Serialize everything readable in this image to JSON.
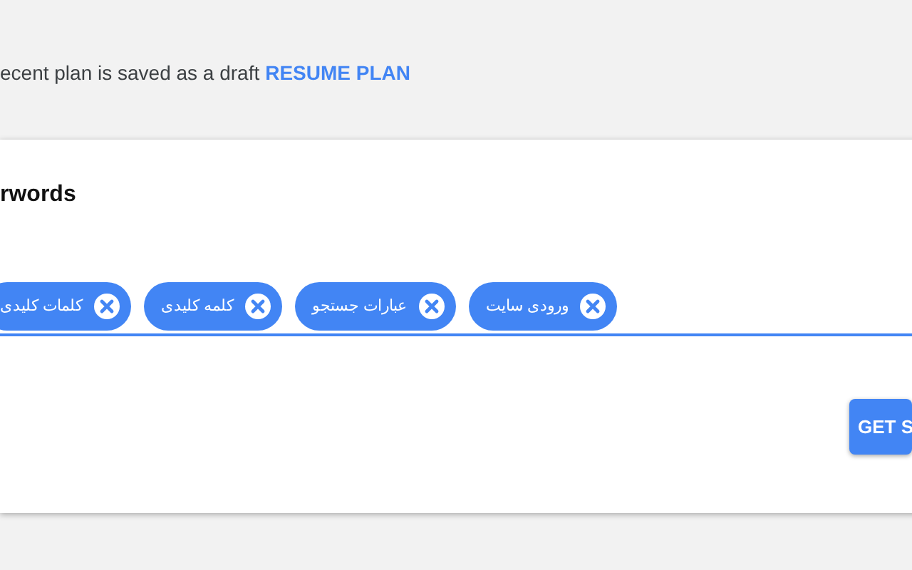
{
  "draft_notice": {
    "text": "ecent plan is saved as a draft",
    "link": "RESUME PLAN"
  },
  "card": {
    "title": "rwords",
    "chips": [
      {
        "label": "ورودی سایت"
      },
      {
        "label": "عبارات جستجو"
      },
      {
        "label": "کلمه کلیدی"
      },
      {
        "label": "کلمات کلیدی"
      }
    ],
    "button": "GET S"
  }
}
